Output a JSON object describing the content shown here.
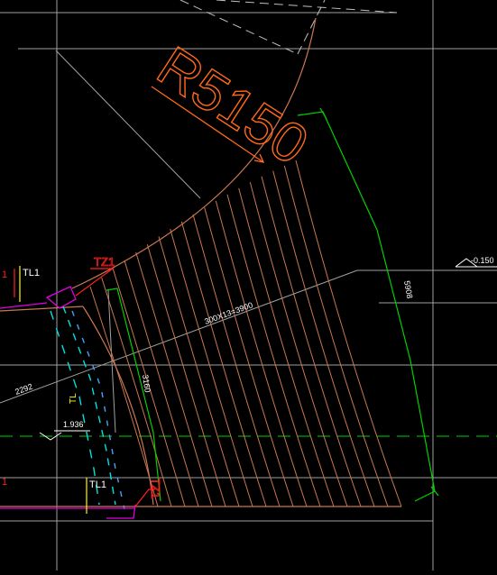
{
  "drawing": {
    "radius_label": "R5150",
    "step_dimension": "300X13=3900",
    "left_dim": "2292",
    "right_arc_dim": "5908",
    "inner_arc_dim": "3160",
    "level_right": "-0.150",
    "level_left": "1.936",
    "tz_top": "TZ1",
    "tz_bottom": "TZ1",
    "tl_top": "TL1",
    "tl_bottom": "TL1",
    "tl_left_edge": "1",
    "tl_left_edge_bottom": "1",
    "landing_mark": "TL"
  },
  "colors": {
    "background": "#000000",
    "stair_lines": "#c87850",
    "arc_outer": "#c87850",
    "dimension_green": "#00d000",
    "grid_gray": "#a0a0a0",
    "radius_orange": "#ff6a1a",
    "label_red": "#ff2020",
    "tl_yellow": "#ffff00",
    "cyan": "#00e0e0",
    "magenta": "#e000e0",
    "white": "#ffffff"
  }
}
